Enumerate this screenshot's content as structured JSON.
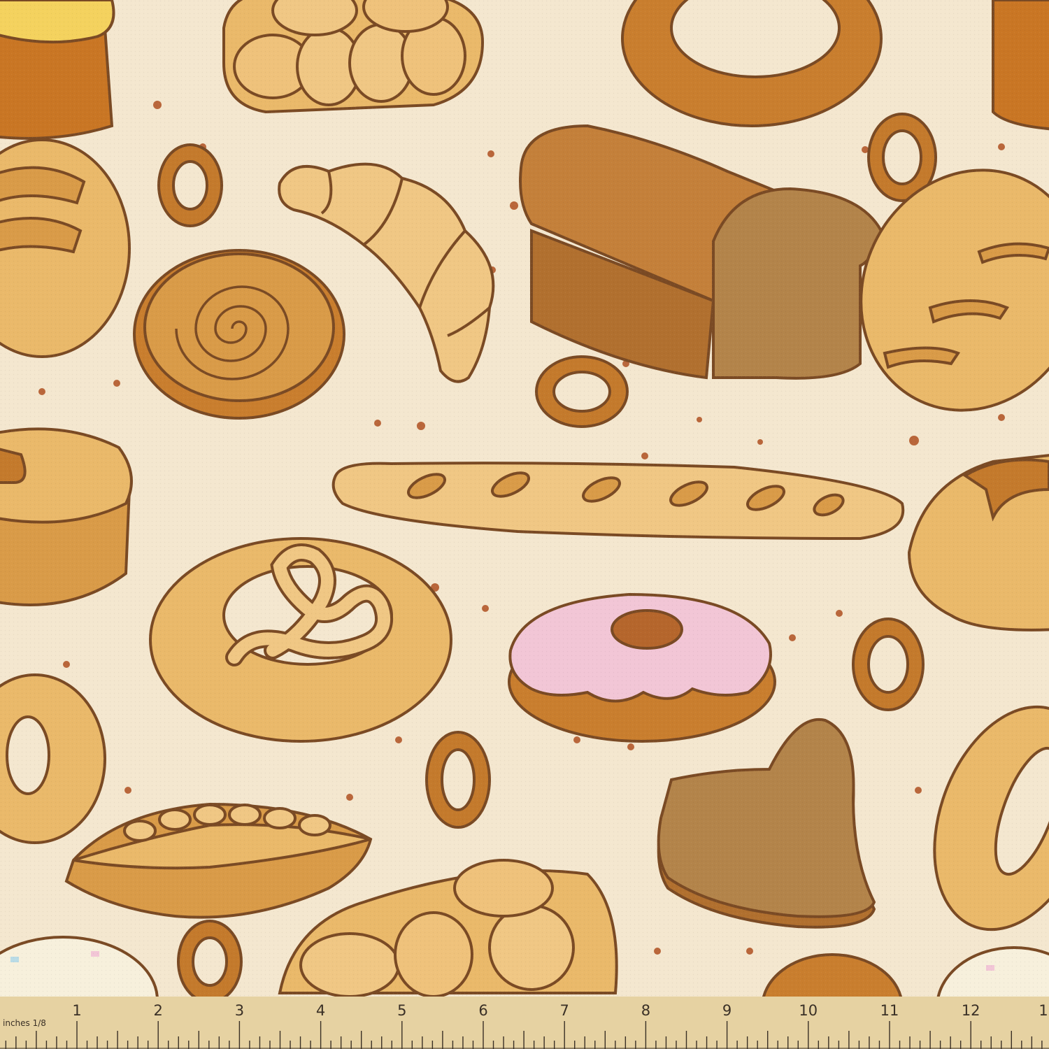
{
  "colors": {
    "background": "#f4e7cf",
    "outline": "#7a4a24",
    "crust_light": "#f0c784",
    "crust_mid": "#d99b48",
    "crust_dark": "#c47a2c",
    "brown_bread": "#b47a3e",
    "donut_icing": "#f2c6d6",
    "ruler": "#e6d2a2"
  },
  "ruler": {
    "unit_label": "inches 1/8",
    "numbers": [
      "1",
      "2",
      "3",
      "4",
      "5",
      "6",
      "7",
      "8",
      "9",
      "10",
      "11",
      "12",
      "1"
    ]
  }
}
